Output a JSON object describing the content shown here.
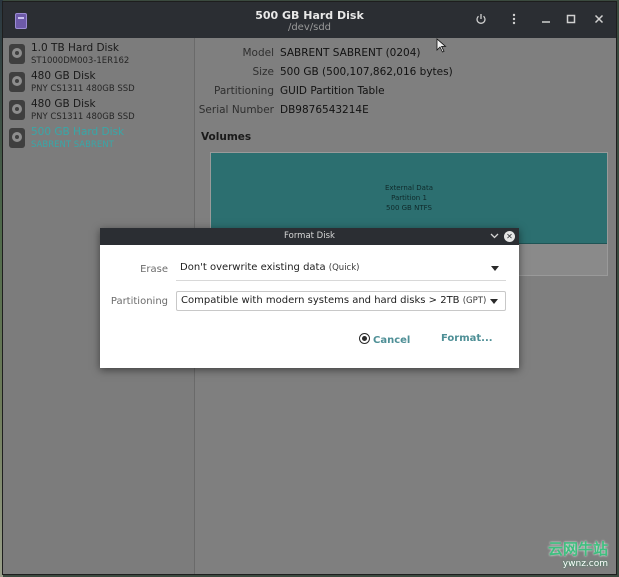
{
  "window": {
    "title": "500 GB Hard Disk",
    "subtitle": "/dev/sdd"
  },
  "titlebar_buttons": {
    "power_icon": "power-icon",
    "menu_icon": "vertical-ellipsis-icon",
    "minimize_icon": "minimize-icon",
    "maximize_icon": "maximize-icon",
    "close_icon": "close-icon"
  },
  "sidebar": {
    "drives": [
      {
        "name": "1.0 TB Hard Disk",
        "model": "ST1000DM003-1ER162",
        "selected": false
      },
      {
        "name": "480 GB Disk",
        "model": "PNY CS1311 480GB SSD",
        "selected": false
      },
      {
        "name": "480 GB Disk",
        "model": "PNY CS1311 480GB SSD",
        "selected": false
      },
      {
        "name": "500 GB Hard Disk",
        "model": "SABRENT SABRENT",
        "selected": true
      }
    ]
  },
  "details": {
    "model_label": "Model",
    "model_value": "SABRENT SABRENT (0204)",
    "size_label": "Size",
    "size_value": "500 GB (500,107,862,016 bytes)",
    "partitioning_label": "Partitioning",
    "partitioning_value": "GUID Partition Table",
    "serial_label": "Serial Number",
    "serial_value": "DB9876543214E"
  },
  "volumes": {
    "title": "Volumes",
    "partition": {
      "line1": "External Data",
      "line2": "Partition 1",
      "line3": "500 GB NTFS",
      "color": "#2c6f70"
    }
  },
  "dialog": {
    "title": "Format Disk",
    "erase_label": "Erase",
    "erase_value": "Don't overwrite existing data",
    "erase_value_hint": "(Quick)",
    "partitioning_label": "Partitioning",
    "partitioning_value": "Compatible with modern systems and hard disks > 2TB",
    "partitioning_value_hint": "(GPT)",
    "cancel_label": "Cancel",
    "format_label": "Format..."
  },
  "watermark": {
    "line1": "云网牛站",
    "line2": "ywnz.com"
  },
  "colors": {
    "accent": "#38a7a8",
    "button_text": "#4e8f96",
    "titlebar": "#2b2e33",
    "watermark": "#3fbf7f"
  }
}
